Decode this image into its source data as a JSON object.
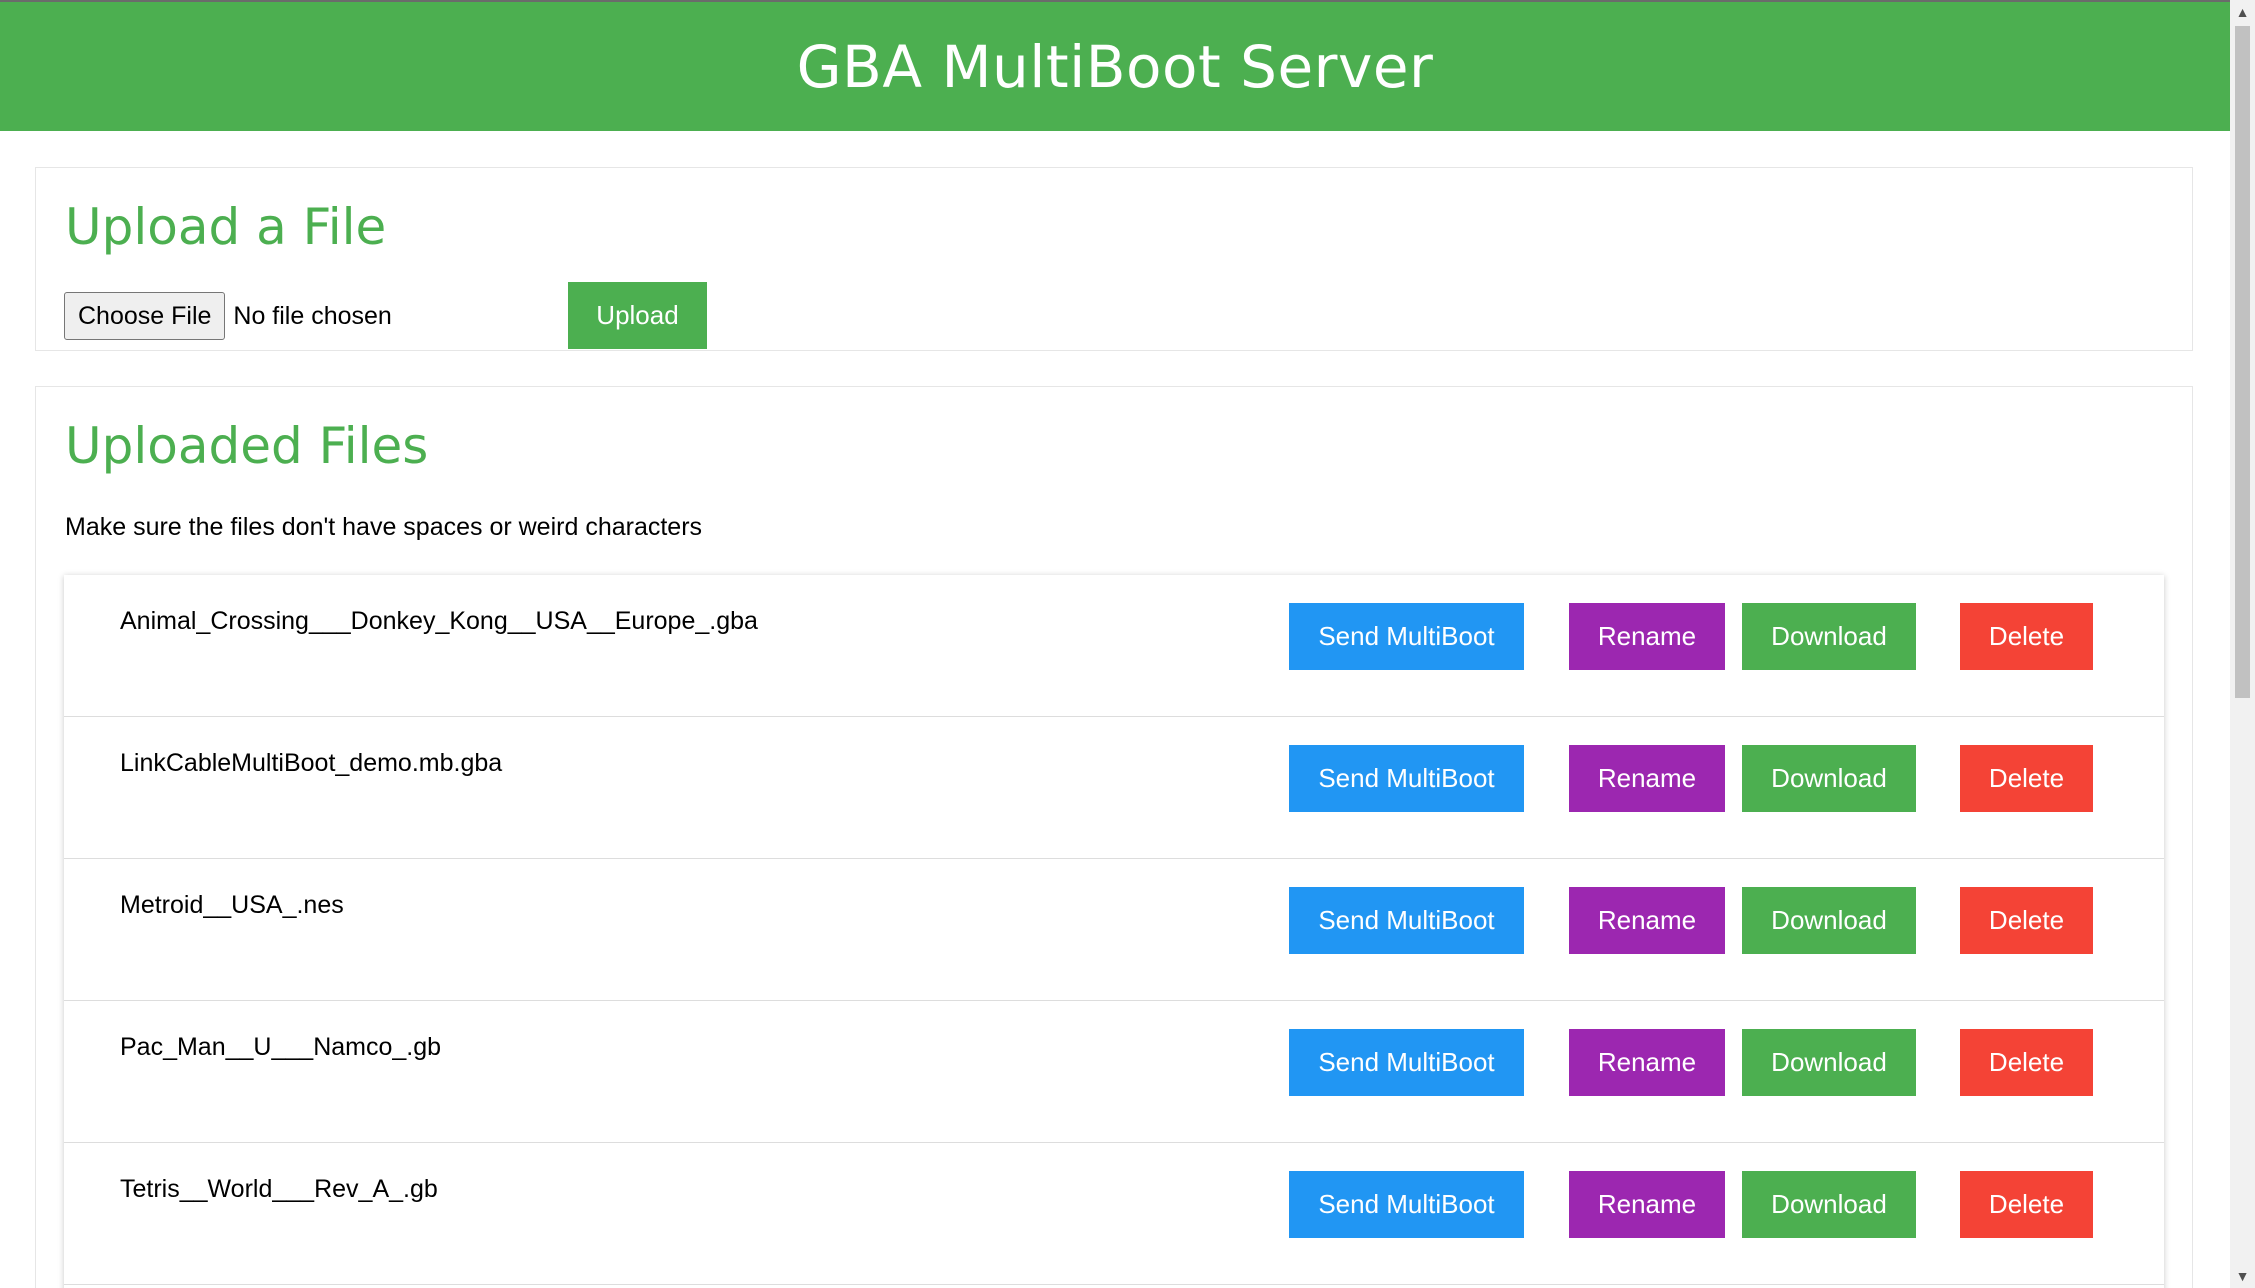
{
  "header": {
    "title": "GBA MultiBoot Server"
  },
  "upload": {
    "title": "Upload a File",
    "choose_label": "Choose File",
    "no_file_text": "No file chosen",
    "upload_label": "Upload"
  },
  "files": {
    "title": "Uploaded Files",
    "notice": "Make sure the files don't have spaces or weird characters",
    "actions": {
      "send": "Send MultiBoot",
      "rename": "Rename",
      "download": "Download",
      "delete": "Delete"
    },
    "items": [
      {
        "name": "Animal_Crossing___Donkey_Kong__USA__Europe_.gba"
      },
      {
        "name": "LinkCableMultiBoot_demo.mb.gba"
      },
      {
        "name": "Metroid__USA_.nes"
      },
      {
        "name": "Pac_Man__U___Namco_.gb"
      },
      {
        "name": "Tetris__World___Rev_A_.gb"
      }
    ]
  },
  "scrollbar": {
    "up_icon": "triangle-up",
    "down_icon": "triangle-down"
  }
}
